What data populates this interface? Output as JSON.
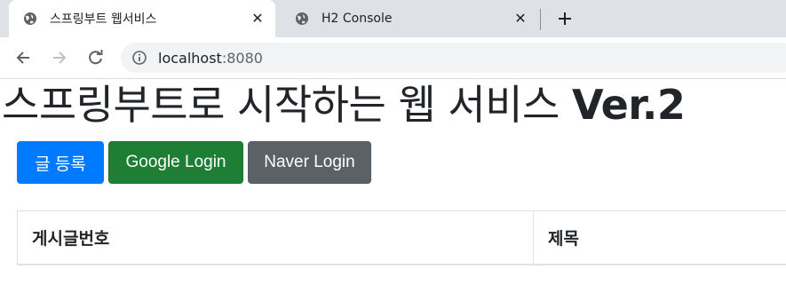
{
  "browser": {
    "tabs": [
      {
        "title": "스프링부트 웹서비스",
        "active": true
      },
      {
        "title": "H2 Console",
        "active": false
      }
    ],
    "address": {
      "host": "localhost",
      "port": ":8080"
    }
  },
  "page": {
    "title": "스프링부트로 시작하는 웹 서비스",
    "version": "Ver.2",
    "buttons": {
      "register": "글 등록",
      "google_login": "Google Login",
      "naver_login": "Naver Login"
    },
    "table": {
      "columns": [
        "게시글번호",
        "제목"
      ]
    }
  },
  "colors": {
    "primary": "#007bff",
    "success": "#1e7e34",
    "secondary": "#5a6268"
  }
}
